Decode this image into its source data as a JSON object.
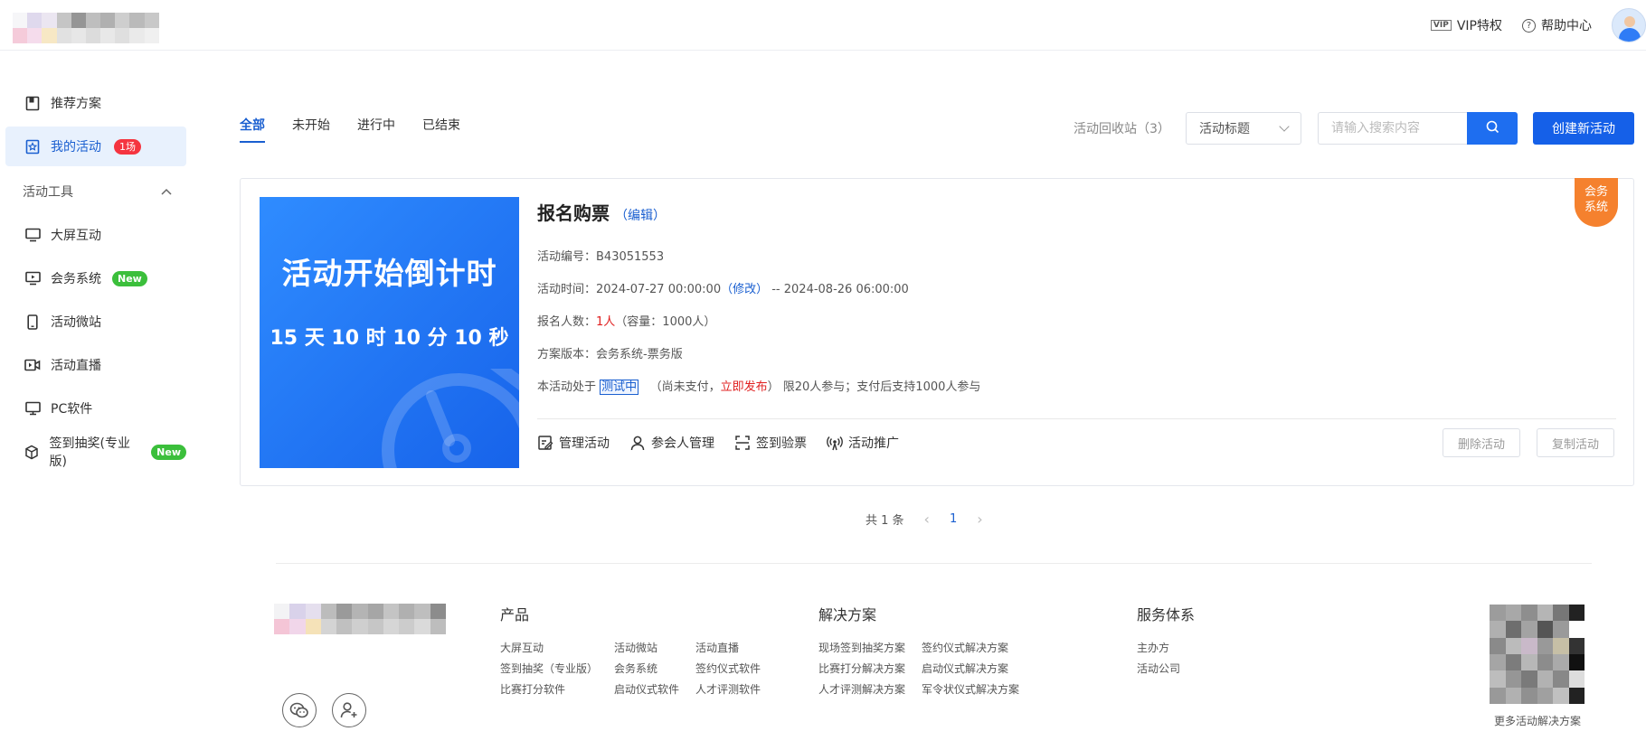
{
  "header": {
    "vip_label": "VIP特权",
    "vip_badge": "VIP",
    "help_label": "帮助中心"
  },
  "sidebar": {
    "items": [
      {
        "label": "推荐方案",
        "icon": "book-icon"
      },
      {
        "label": "我的活动",
        "icon": "star-doc-icon",
        "badge": "1场"
      },
      {
        "label": "大屏互动",
        "icon": "monitor-icon"
      },
      {
        "label": "会务系统",
        "icon": "presentation-icon",
        "badge": "New"
      },
      {
        "label": "活动微站",
        "icon": "phone-icon"
      },
      {
        "label": "活动直播",
        "icon": "video-icon"
      },
      {
        "label": "PC软件",
        "icon": "desktop-icon"
      },
      {
        "label": "签到抽奖(专业版)",
        "icon": "cube-icon",
        "badge": "New"
      }
    ],
    "group_label": "活动工具"
  },
  "tabs": [
    "全部",
    "未开始",
    "进行中",
    "已结束"
  ],
  "toolbar": {
    "recycle": "活动回收站（3）",
    "select_value": "活动标题",
    "search_placeholder": "请输入搜索内容",
    "create_label": "创建新活动"
  },
  "activity": {
    "poster_title": "活动开始倒计时",
    "poster_countdown": "15 天 10 时 10 分 10 秒",
    "title": "报名购票",
    "edit": "（编辑）",
    "corner_line1": "会务",
    "corner_line2": "系统",
    "id_label": "活动编号：",
    "id_value": "B43051553",
    "time_label": "活动时间：",
    "time_start": "2024-07-27 00:00:00",
    "time_modify": "（修改）",
    "time_end": " -- 2024-08-26 06:00:00",
    "count_label": "报名人数：",
    "count_value": "1人",
    "capacity": "（容量：1000人）",
    "version_label": "方案版本：",
    "version_value": "会务系统-票务版",
    "status_prefix": "本活动处于",
    "status_tag": "测试中",
    "status_paren_open": "（尚未支付，",
    "status_publish": "立即发布",
    "status_paren_close": "）",
    "status_suffix": "限20人参与；支付后支持1000人参与",
    "actions": [
      "管理活动",
      "参会人管理",
      "签到验票",
      "活动推广"
    ],
    "delete_label": "删除活动",
    "copy_label": "复制活动"
  },
  "pagination": {
    "total": "共 1 条",
    "current": "1"
  },
  "footer": {
    "products_title": "产品",
    "products": [
      "大屏互动",
      "活动微站",
      "活动直播",
      "签到抽奖（专业版）",
      "会务系统",
      "签约仪式软件",
      "比赛打分软件",
      "启动仪式软件",
      "人才评测软件"
    ],
    "solutions_title": "解决方案",
    "solutions": [
      "现场签到抽奖方案",
      "签约仪式解决方案",
      "比赛打分解决方案",
      "启动仪式解决方案",
      "人才评测解决方案",
      "军令状仪式解决方案"
    ],
    "services_title": "服务体系",
    "services": [
      "主办方",
      "活动公司"
    ],
    "qr_caption": "更多活动解决方案"
  },
  "colors": {
    "primary": "#1560e8",
    "accent_orange": "#f5812e",
    "badge_red": "#f5343f",
    "badge_green": "#3bbf3b"
  }
}
